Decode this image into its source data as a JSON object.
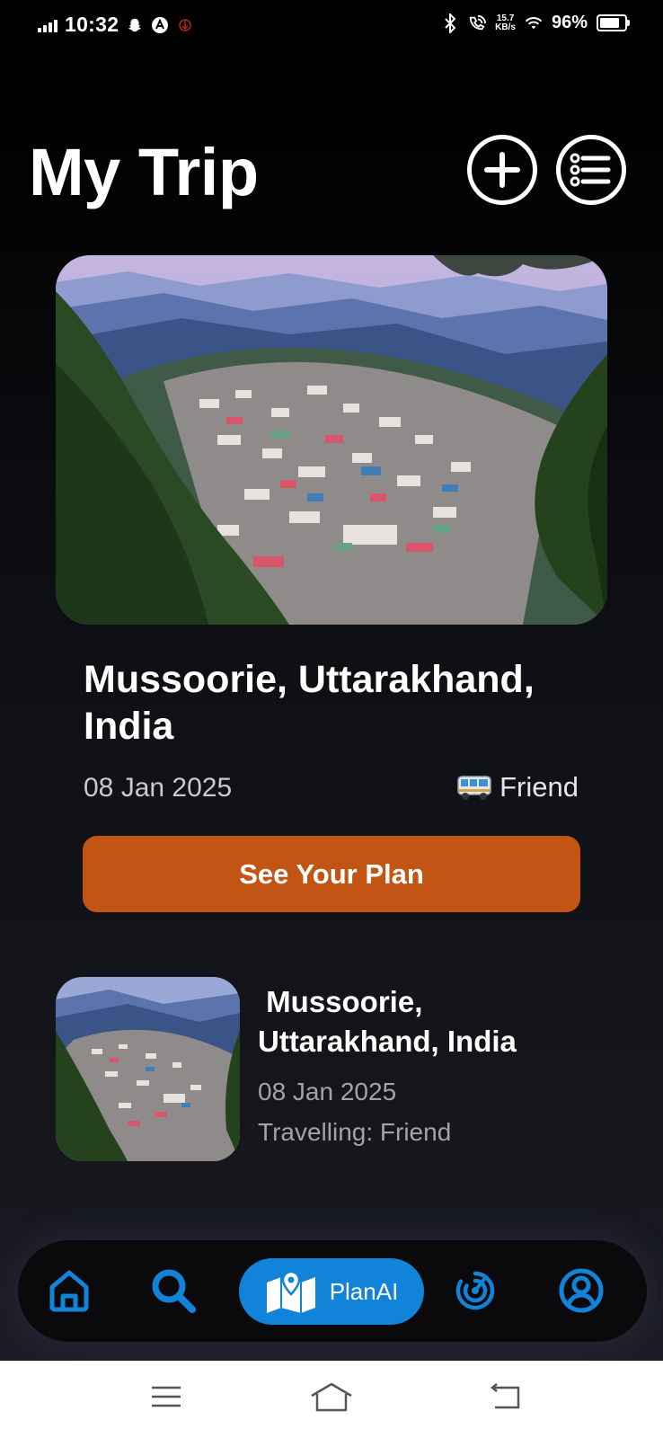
{
  "status_bar": {
    "time": "10:32",
    "net_speed_value": "15.7",
    "net_speed_unit": "KB/s",
    "battery_percent": "96%",
    "battery_level": 0.96
  },
  "header": {
    "title": "My Trip",
    "add_icon": "plus-circle-icon",
    "list_icon": "list-icon"
  },
  "featured_trip": {
    "destination": "Mussoorie, Uttarakhand, India",
    "date": "08 Jan 2025",
    "companion_icon": "bus-icon",
    "companion": "Friend",
    "cta_label": "See Your Plan",
    "cta_color": "#c25414"
  },
  "trips": [
    {
      "destination": " Mussoorie,\nUttarakhand, India",
      "date": "08 Jan 2025",
      "travelling": "Travelling: Friend"
    }
  ],
  "bottom_nav": {
    "accent_color": "#1183d8",
    "items": [
      {
        "icon": "home-icon"
      },
      {
        "icon": "search-icon"
      },
      {
        "icon": "map-pin-icon",
        "label": "PlanAI",
        "active": true
      },
      {
        "icon": "radar-icon"
      },
      {
        "icon": "profile-icon"
      }
    ]
  }
}
